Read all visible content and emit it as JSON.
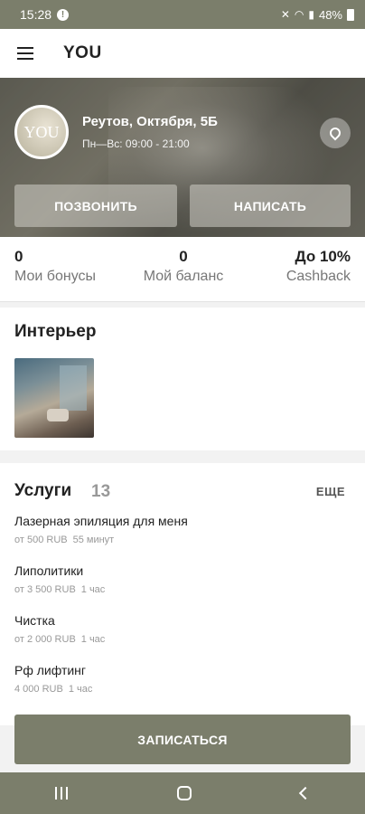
{
  "status_bar": {
    "time": "15:28",
    "battery": "48%"
  },
  "app_bar": {
    "title": "YOU"
  },
  "salon": {
    "avatar_text": "YOU",
    "address": "Реутов, Октября, 5Б",
    "hours": "Пн—Вс: 09:00 - 21:00",
    "call_label": "ПОЗВОНИТЬ",
    "write_label": "НАПИСАТЬ"
  },
  "stats": {
    "bonus": {
      "value": "0",
      "label": "Мои бонусы"
    },
    "balance": {
      "value": "0",
      "label": "Мой баланс"
    },
    "cashback": {
      "value": "До 10%",
      "label": "Cashback"
    }
  },
  "interior": {
    "title": "Интерьер"
  },
  "services": {
    "title": "Услуги",
    "count": "13",
    "more_label": "ЕЩЕ",
    "items": [
      {
        "name": "Лазерная эпиляция для меня",
        "price": "от 500 RUB",
        "duration": "55 минут"
      },
      {
        "name": "Липолитики",
        "price": "от 3 500 RUB",
        "duration": "1 час"
      },
      {
        "name": "Чистка",
        "price": "от 2 000 RUB",
        "duration": "1 час"
      },
      {
        "name": "Рф лифтинг",
        "price": "4 000 RUB",
        "duration": "1 час"
      }
    ]
  },
  "book_label": "ЗАПИСАТЬСЯ"
}
